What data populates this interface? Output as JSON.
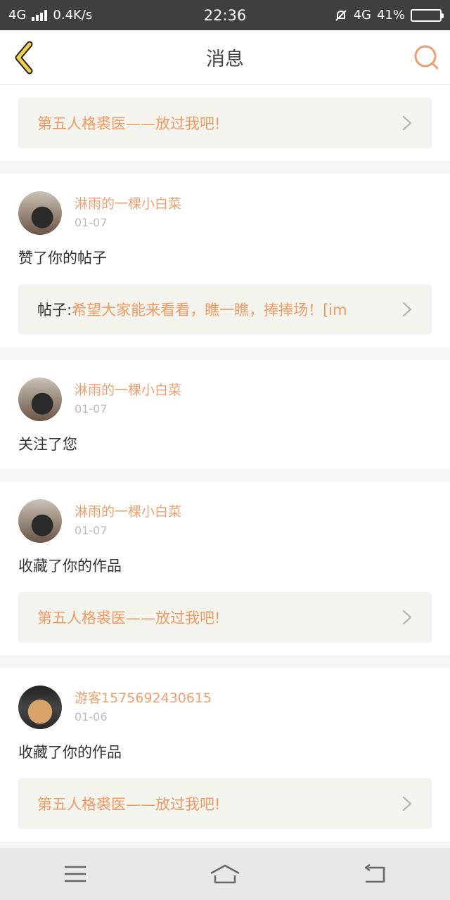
{
  "status_bar": {
    "network": "4G",
    "speed": "0.4K/s",
    "time": "22:36",
    "network_right": "4G",
    "battery": "41%",
    "battery_level": 0.41
  },
  "navbar": {
    "title": "消息",
    "back_icon": "back-chevron-icon",
    "search_icon": "search-icon"
  },
  "top_link": {
    "text": "第五人格裘医——放过我吧!"
  },
  "messages": [
    {
      "username": "淋雨的一棵小白菜",
      "date": "01-07",
      "action": "赞了你的帖子",
      "link_prefix": "帖子:",
      "link_text": "希望大家能来看看，瞧一瞧，捧捧场！[im"
    },
    {
      "username": "淋雨的一棵小白菜",
      "date": "01-07",
      "action": "关注了您"
    },
    {
      "username": "淋雨的一棵小白菜",
      "date": "01-07",
      "action": "收藏了你的作品",
      "link_text": "第五人格裘医——放过我吧!"
    },
    {
      "username": "游客1575692430615",
      "date": "01-06",
      "action": "收藏了你的作品",
      "link_text": "第五人格裘医——放过我吧!"
    }
  ],
  "colors": {
    "accent": "#ef9a64",
    "back_icon": "#e8c020",
    "search_icon": "#f0a070"
  },
  "system_nav": [
    "menu-icon",
    "home-icon",
    "back-icon"
  ]
}
